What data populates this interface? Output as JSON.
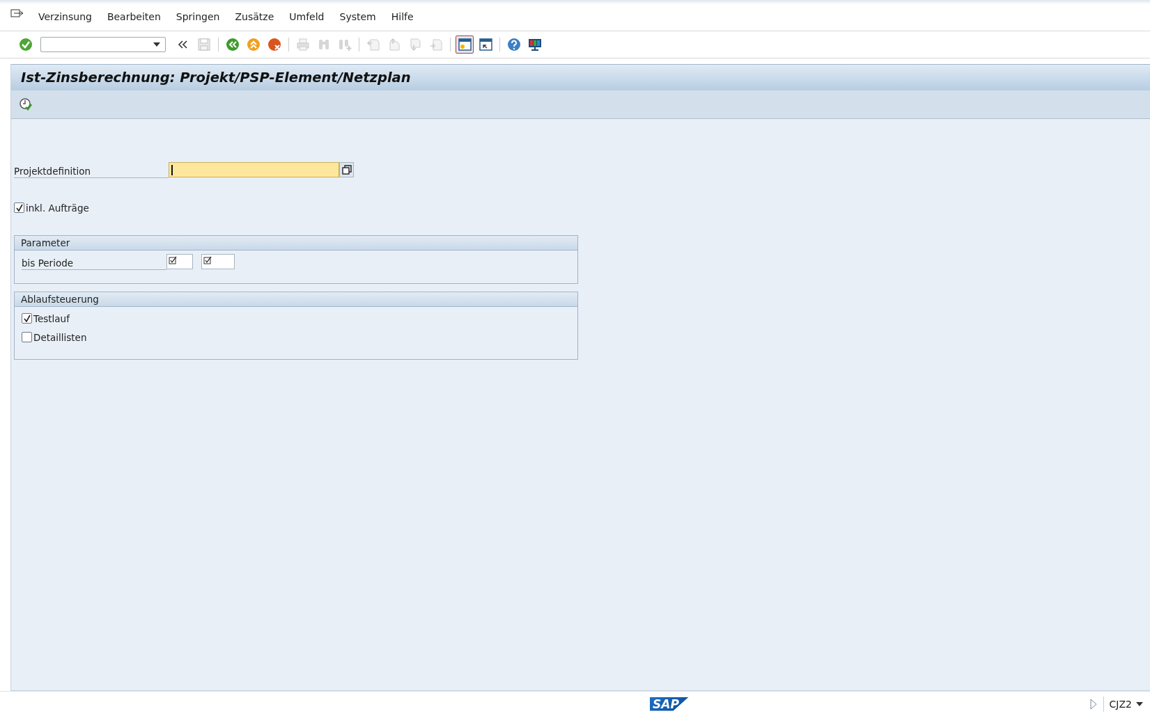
{
  "menu": [
    {
      "label": "Verzinsung"
    },
    {
      "label": "Bearbeiten"
    },
    {
      "label": "Springen"
    },
    {
      "label": "Zusätze"
    },
    {
      "label": "Umfeld"
    },
    {
      "label": "System"
    },
    {
      "label": "Hilfe"
    }
  ],
  "toolbar": [
    {
      "kind": "enter",
      "disabled": false,
      "focused": false
    },
    {
      "kind": "command"
    },
    {
      "kind": "collapse",
      "disabled": false,
      "focused": false
    },
    {
      "kind": "save",
      "disabled": true,
      "focused": false
    },
    {
      "kind": "sep"
    },
    {
      "kind": "back",
      "disabled": false,
      "focused": false
    },
    {
      "kind": "exit",
      "disabled": false,
      "focused": false
    },
    {
      "kind": "cancel",
      "disabled": false,
      "focused": false
    },
    {
      "kind": "sep"
    },
    {
      "kind": "print",
      "disabled": true,
      "focused": false
    },
    {
      "kind": "find",
      "disabled": true,
      "focused": false
    },
    {
      "kind": "findnext",
      "disabled": true,
      "focused": false
    },
    {
      "kind": "sep"
    },
    {
      "kind": "first",
      "disabled": true,
      "focused": false
    },
    {
      "kind": "prev",
      "disabled": true,
      "focused": false
    },
    {
      "kind": "next",
      "disabled": true,
      "focused": false
    },
    {
      "kind": "last",
      "disabled": true,
      "focused": false
    },
    {
      "kind": "sep"
    },
    {
      "kind": "newsession",
      "disabled": false,
      "focused": true
    },
    {
      "kind": "shortcut",
      "disabled": false,
      "focused": false
    },
    {
      "kind": "sep"
    },
    {
      "kind": "help",
      "disabled": false,
      "focused": false
    },
    {
      "kind": "layout",
      "disabled": false,
      "focused": false
    }
  ],
  "title": "Ist-Zinsberechnung: Projekt/PSP-Element/Netzplan",
  "fields": {
    "label": "Projektdefinition",
    "focused": true
  },
  "include_orders": {
    "label": "inkl. Aufträge",
    "checked": true
  },
  "groups": [
    {
      "title": "Parameter",
      "rows": [
        {
          "kind": "range",
          "label": "bis Periode",
          "required": true
        }
      ]
    },
    {
      "title": "Ablaufsteuerung",
      "rows": [
        {
          "kind": "checkbox",
          "label": "Testlauf",
          "checked": true
        },
        {
          "kind": "checkbox",
          "label": "Detaillisten",
          "checked": false
        }
      ]
    }
  ],
  "status_bar": {
    "logo": "SAP",
    "transaction": "CJZ2"
  }
}
